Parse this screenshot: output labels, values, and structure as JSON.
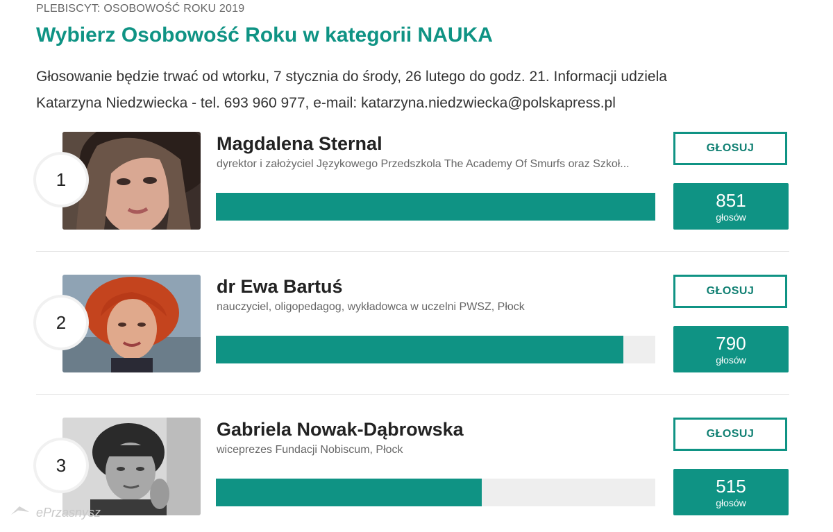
{
  "header": {
    "kicker": "PLEBISCYT: OSOBOWOŚĆ ROKU 2019",
    "title": "Wybierz Osobowość Roku w kategorii NAUKA",
    "description": "Głosowanie będzie trwać od wtorku, 7 stycznia do środy, 26 lutego do godz. 21. Informacji udziela Katarzyna Niedzwiecka - tel. 693 960 977, e-mail: katarzyna.niedzwiecka@polskapress.pl"
  },
  "vote_label": "GŁOSUJ",
  "votes_label": "głosów",
  "candidates": [
    {
      "rank": "1",
      "name": "Magdalena Sternal",
      "role": "dyrektor i założyciel Językowego Przedszkola The Academy Of Smurfs oraz Szkoł...",
      "votes": "851",
      "share": 1.0
    },
    {
      "rank": "2",
      "name": "dr Ewa Bartuś",
      "role": "nauczyciel, oligopedagog, wykładowca w uczelni PWSZ, Płock",
      "votes": "790",
      "share": 0.928
    },
    {
      "rank": "3",
      "name": "Gabriela Nowak-Dąbrowska",
      "role": "wiceprezes Fundacji Nobiscum, Płock",
      "votes": "515",
      "share": 0.605
    }
  ],
  "watermark": "ePrzasnysz",
  "colors": {
    "accent": "#0f9384",
    "track": "#eeeeee"
  }
}
